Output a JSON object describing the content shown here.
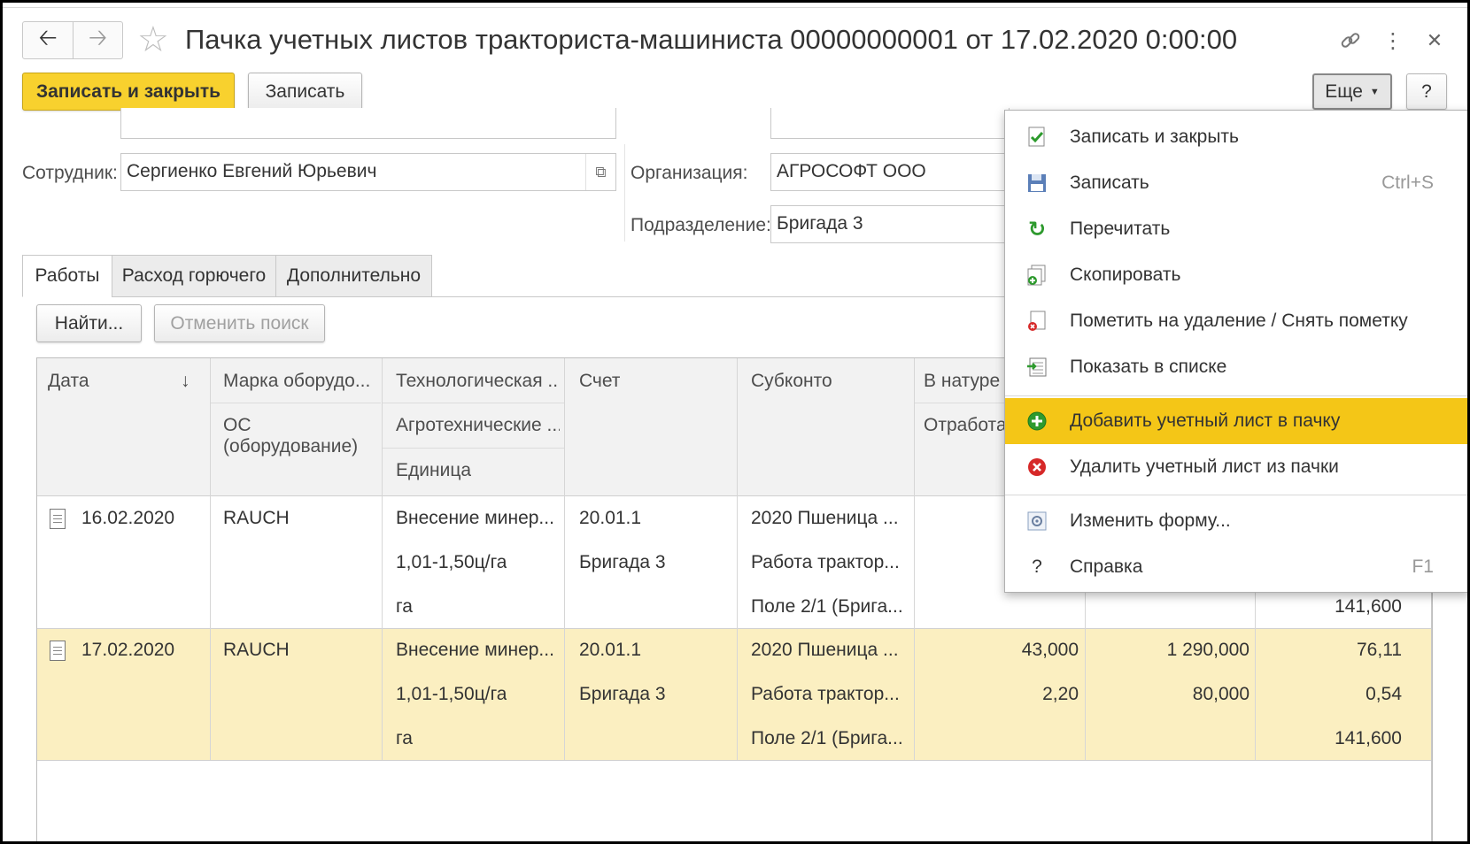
{
  "window": {
    "title": "Пачка учетных листов тракториста-машиниста 00000000001 от 17.02.2020 0:00:00"
  },
  "toolbar": {
    "save_close_label": "Записать и закрыть",
    "save_label": "Записать",
    "more_label": "Еще",
    "help_label": "?"
  },
  "form": {
    "employee_label": "Сотрудник:",
    "employee_value": "Сергиенко Евгений Юрьевич",
    "org_label": "Организация:",
    "org_value": "АГРОСОФТ ООО",
    "division_label": "Подразделение:",
    "division_value": "Бригада 3"
  },
  "tabs": [
    "Работы",
    "Расход горючего",
    "Дополнительно"
  ],
  "search": {
    "find_label": "Найти...",
    "cancel_label": "Отменить поиск"
  },
  "table": {
    "headers": {
      "date": "Дата",
      "sort_arrow": "↓",
      "brand": "Марка оборудо...",
      "os": "ОС\n(оборудование)",
      "tech": "Технологическая ...",
      "agro": "Агротехнические ...",
      "unit": "Единица",
      "account": "Счет",
      "subconto": "Субконто",
      "natura": "В натуре",
      "worked": "Отработа"
    },
    "rows": [
      {
        "date": "16.02.2020",
        "brand": "RAUCH",
        "tech": "Внесение минер...",
        "agro": "1,01-1,50ц/га",
        "unit": "га",
        "account": "20.01.1",
        "account2": "Бригада 3",
        "sub1": "2020 Пшеница ...",
        "sub2": "Работа трактор...",
        "sub3": "Поле 2/1 (Брига...",
        "n1": "",
        "n2": "",
        "n3": "",
        "m1": "",
        "m2": "",
        "m3": "",
        "k1": "",
        "k2": "",
        "k3": "141,600"
      },
      {
        "date": "17.02.2020",
        "brand": "RAUCH",
        "tech": "Внесение минер...",
        "agro": "1,01-1,50ц/га",
        "unit": "га",
        "account": "20.01.1",
        "account2": "Бригада 3",
        "sub1": "2020 Пшеница ...",
        "sub2": "Работа трактор...",
        "sub3": "Поле 2/1 (Брига...",
        "n1": "43,000",
        "n2": "2,20",
        "n3": "",
        "m1": "1 290,000",
        "m2": "80,000",
        "m3": "",
        "k1": "76,11",
        "k2": "0,54",
        "k3": "141,600"
      }
    ]
  },
  "menu": {
    "items": [
      {
        "label": "Записать и закрыть",
        "shortcut": ""
      },
      {
        "label": "Записать",
        "shortcut": "Ctrl+S"
      },
      {
        "label": "Перечитать",
        "shortcut": ""
      },
      {
        "label": "Скопировать",
        "shortcut": ""
      },
      {
        "label": "Пометить на удаление / Снять пометку",
        "shortcut": ""
      },
      {
        "label": "Показать в списке",
        "shortcut": ""
      },
      {
        "label": "Добавить учетный лист в пачку",
        "shortcut": ""
      },
      {
        "label": "Удалить учетный лист из пачки",
        "shortcut": ""
      },
      {
        "label": "Изменить форму...",
        "shortcut": ""
      },
      {
        "label": "Справка",
        "shortcut": "F1"
      }
    ],
    "highlight_color": "#f4c617"
  },
  "colors": {
    "primary_button": "#f8d12e",
    "selected_row": "#fbefc1"
  }
}
